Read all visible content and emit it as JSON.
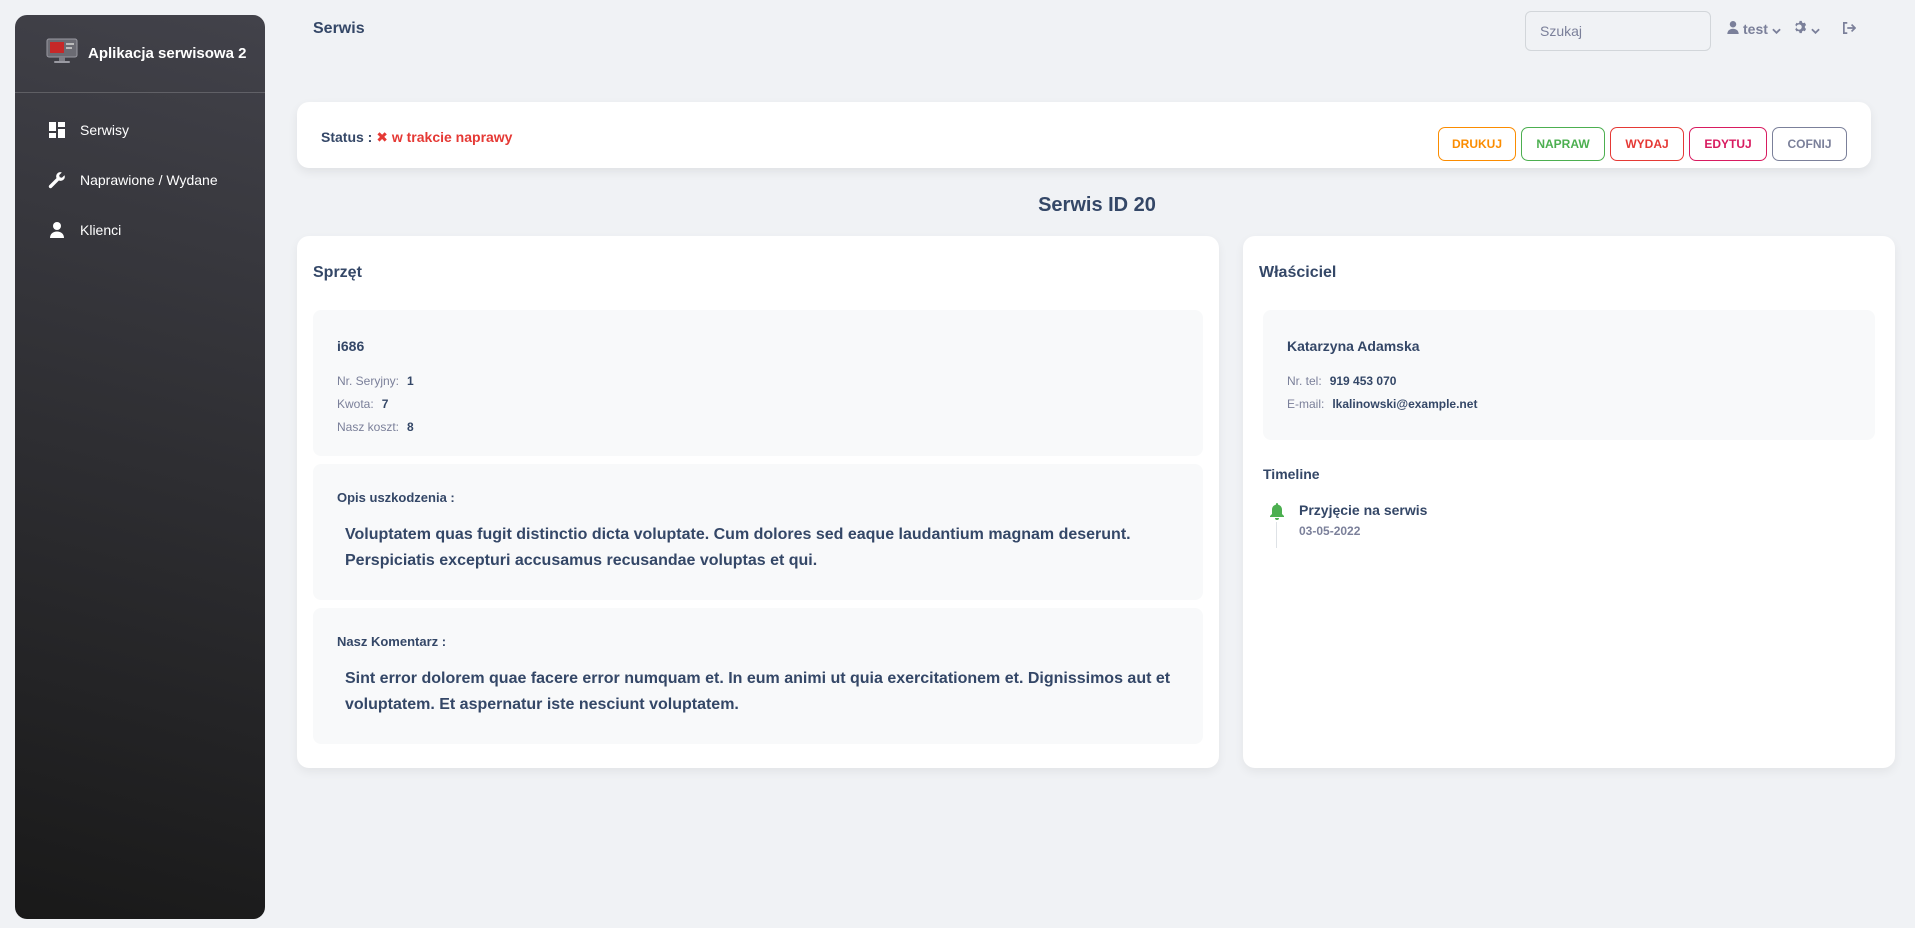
{
  "sidebar": {
    "brand_title": "Aplikacja serwisowa 2",
    "items": [
      {
        "label": "Serwisy",
        "icon": "dashboard-icon"
      },
      {
        "label": "Naprawione / Wydane",
        "icon": "wrench-icon"
      },
      {
        "label": "Klienci",
        "icon": "person-icon"
      }
    ]
  },
  "topbar": {
    "title": "Serwis",
    "search_placeholder": "Szukaj",
    "user_name": "test"
  },
  "status": {
    "label": "Status :",
    "value": "w trakcie naprawy",
    "value_color": "#e53935"
  },
  "actions": {
    "drukuj": "DRUKUJ",
    "napraw": "NAPRAW",
    "wydaj": "WYDAJ",
    "edytuj": "EDYTUJ",
    "cofnij": "COFNIJ"
  },
  "page_heading": "Serwis ID 20",
  "sprzet": {
    "title": "Sprzęt",
    "device_name": "i686",
    "serial_label": "Nr. Seryjny:",
    "serial_value": "1",
    "amount_label": "Kwota:",
    "amount_value": "7",
    "cost_label": "Nasz koszt:",
    "cost_value": "8",
    "damage_label": "Opis uszkodzenia :",
    "damage_text": "Voluptatem quas fugit distinctio dicta voluptate. Cum dolores sed eaque laudantium magnam deserunt. Perspiciatis excepturi accusamus recusandae voluptas et qui.",
    "comment_label": "Nasz Komentarz :",
    "comment_text": "Sint error dolorem quae facere error numquam et. In eum animi ut quia exercitationem et. Dignissimos aut et voluptatem. Et aspernatur iste nesciunt voluptatem."
  },
  "owner": {
    "title": "Właściciel",
    "name": "Katarzyna Adamska",
    "phone_label": "Nr. tel:",
    "phone_value": "919 453 070",
    "email_label": "E-mail:",
    "email_value": "lkalinowski@example.net"
  },
  "timeline": {
    "title": "Timeline",
    "items": [
      {
        "title": "Przyjęcie na serwis",
        "date": "03-05-2022",
        "icon": "bell-icon",
        "color": "#4caf50"
      }
    ]
  },
  "colors": {
    "accent_green": "#4caf50",
    "accent_orange": "#fb8c00",
    "accent_red": "#e53935",
    "accent_pink": "#d81b60",
    "text_dark": "#344767",
    "text_muted": "#7b809a"
  }
}
